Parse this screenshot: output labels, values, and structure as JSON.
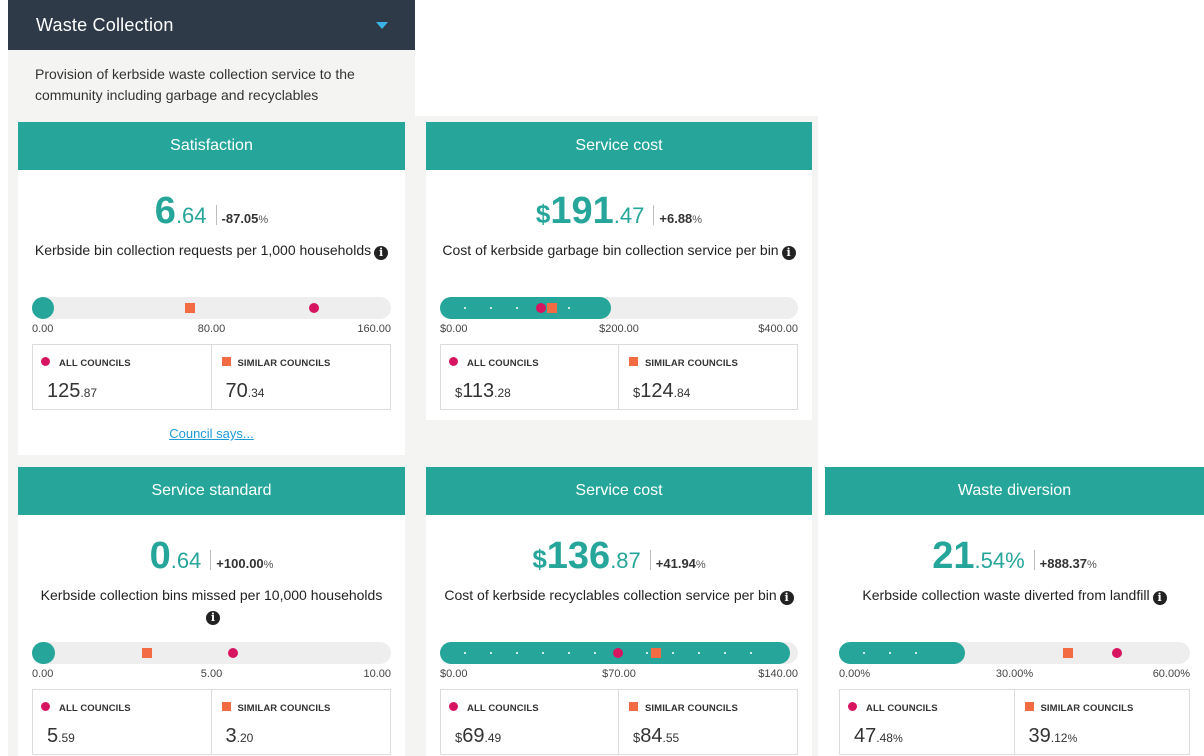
{
  "section": {
    "title": "Waste Collection",
    "description": "Provision of kerbside waste collection service to the community including garbage and recyclables"
  },
  "colors": {
    "header": "#2f3a48",
    "accent": "#26a69a",
    "all_councils": "#d6145f",
    "similar_councils": "#f26b43",
    "link": "#1e9bd7"
  },
  "legend": {
    "all": "ALL COUNCILS",
    "similar": "SIMILAR COUNCILS"
  },
  "cards": [
    {
      "heading": "Satisfaction",
      "value": {
        "currency": "",
        "int": "6",
        "dec": ".64",
        "unit": ""
      },
      "change": {
        "value": "-87.05",
        "unit": "%"
      },
      "description": "Kerbside bin collection requests per 1,000 households",
      "scale": {
        "min": 0,
        "max": 160,
        "ticks": [
          "0.00",
          "80.00",
          "160.00"
        ]
      },
      "measure": 6.64,
      "all": {
        "value": 125.87,
        "currency": "",
        "int": "125",
        "dec": ".87",
        "unit": ""
      },
      "similar": {
        "value": 70.34,
        "currency": "",
        "int": "70",
        "dec": ".34",
        "unit": ""
      },
      "link": "Council says..."
    },
    {
      "heading": "Service cost",
      "value": {
        "currency": "$",
        "int": "191",
        "dec": ".47",
        "unit": ""
      },
      "change": {
        "value": "+6.88",
        "unit": "%"
      },
      "description": "Cost of kerbside garbage bin collection service per bin",
      "scale": {
        "min": 0,
        "max": 400,
        "ticks": [
          "$0.00",
          "$200.00",
          "$400.00"
        ]
      },
      "measure": 191.47,
      "all": {
        "value": 113.28,
        "currency": "$",
        "int": "113",
        "dec": ".28",
        "unit": ""
      },
      "similar": {
        "value": 124.84,
        "currency": "$",
        "int": "124",
        "dec": ".84",
        "unit": ""
      }
    },
    {
      "heading": "Service standard",
      "value": {
        "currency": "",
        "int": "0",
        "dec": ".64",
        "unit": ""
      },
      "change": {
        "value": "+100.00",
        "unit": "%"
      },
      "description": "Kerbside collection bins missed per 10,000 households",
      "scale": {
        "min": 0,
        "max": 10,
        "ticks": [
          "0.00",
          "5.00",
          "10.00"
        ]
      },
      "measure": 0.64,
      "all": {
        "value": 5.59,
        "currency": "",
        "int": "5",
        "dec": ".59",
        "unit": ""
      },
      "similar": {
        "value": 3.2,
        "currency": "",
        "int": "3",
        "dec": ".20",
        "unit": ""
      }
    },
    {
      "heading": "Service cost",
      "value": {
        "currency": "$",
        "int": "136",
        "dec": ".87",
        "unit": ""
      },
      "change": {
        "value": "+41.94",
        "unit": "%"
      },
      "description": "Cost of kerbside recyclables collection service per bin",
      "scale": {
        "min": 0,
        "max": 140,
        "ticks": [
          "$0.00",
          "$70.00",
          "$140.00"
        ]
      },
      "measure": 136.87,
      "all": {
        "value": 69.49,
        "currency": "$",
        "int": "69",
        "dec": ".49",
        "unit": ""
      },
      "similar": {
        "value": 84.55,
        "currency": "$",
        "int": "84",
        "dec": ".55",
        "unit": ""
      }
    },
    {
      "heading": "Waste diversion",
      "value": {
        "currency": "",
        "int": "21",
        "dec": ".54",
        "unit": "%"
      },
      "change": {
        "value": "+888.37",
        "unit": "%"
      },
      "description": "Kerbside collection waste diverted from landfill",
      "scale": {
        "min": 0,
        "max": 60,
        "ticks": [
          "0.00%",
          "30.00%",
          "60.00%"
        ]
      },
      "measure": 21.54,
      "all": {
        "value": 47.48,
        "currency": "",
        "int": "47",
        "dec": ".48",
        "unit": "%"
      },
      "similar": {
        "value": 39.12,
        "currency": "",
        "int": "39",
        "dec": ".12",
        "unit": "%"
      }
    }
  ]
}
